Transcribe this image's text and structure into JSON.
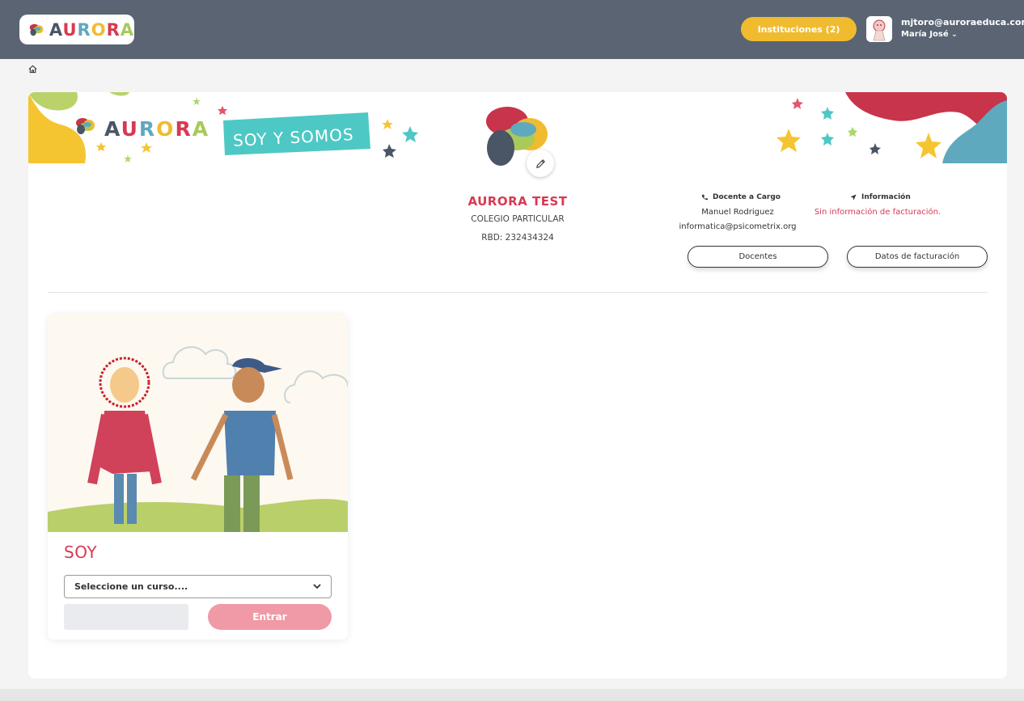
{
  "header": {
    "logo_text": "AURORA",
    "institutions_button": "Instituciones (2)",
    "user_email": "mjtoro@auroraeduca.com",
    "user_name": "María José",
    "chevron": "⌄"
  },
  "banner": {
    "logo_text": "AURORA",
    "tagline": "SOY Y SOMOS"
  },
  "institution": {
    "name": "AURORA TEST",
    "type": "COLEGIO PARTICULAR",
    "rbd": "RBD: 232434324"
  },
  "contact": {
    "teacher_heading": "Docente a Cargo",
    "teacher_name": "Manuel Rodriguez",
    "teacher_email": "informatica@psicometrix.org",
    "info_heading": "Información",
    "info_value": "Sin información de facturación."
  },
  "actions": {
    "teachers_button": "Docentes",
    "billing_button": "Datos de facturación"
  },
  "program": {
    "title": "SOY",
    "select_placeholder": "Seleccione un curso....",
    "enter_button": "Entrar"
  },
  "colors": {
    "header_bg": "#5a6473",
    "accent_yellow": "#f0bb2e",
    "accent_red": "#d63a52",
    "accent_pink": "#ef9aa6",
    "teal": "#5fa9bf"
  },
  "icons": [
    "home-icon",
    "phone-icon",
    "location-arrow-icon",
    "pencil-icon",
    "chevron-down-icon"
  ]
}
